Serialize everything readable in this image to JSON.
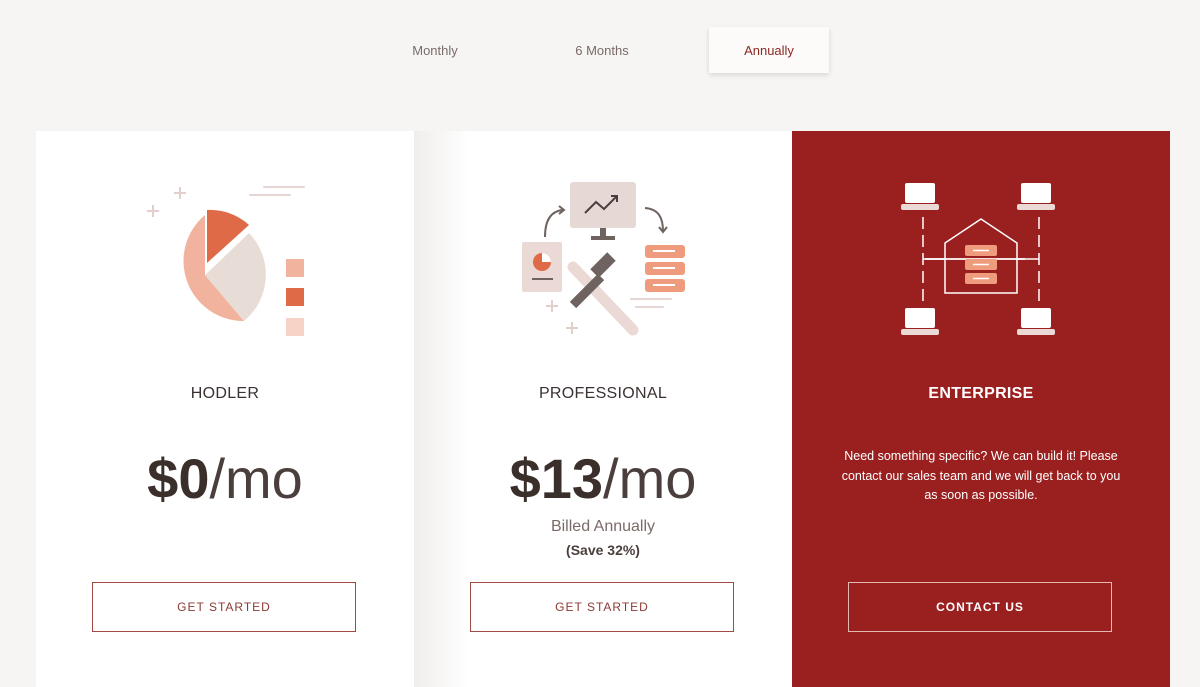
{
  "billing_tabs": [
    {
      "label": "Monthly"
    },
    {
      "label": "6 Months"
    },
    {
      "label": "Annually",
      "selected": true
    }
  ],
  "plans": [
    {
      "name": "HODLER",
      "price_amount": "$0",
      "price_period": "/mo",
      "button_label": "GET STARTED",
      "icon": "pie-chart-illustration"
    },
    {
      "name": "PROFESSIONAL",
      "price_amount": "$13",
      "price_period": "/mo",
      "billed_note": "Billed Annually",
      "savings_note": "(Save 32%)",
      "button_label": "GET STARTED",
      "icon": "tools-illustration"
    },
    {
      "name": "ENTERPRISE",
      "description": "Need something specific? We can build it! Please contact our sales team and we will get back to you as soon as possible.",
      "button_label": "CONTACT US",
      "icon": "network-house-illustration"
    }
  ],
  "colors": {
    "accent": "#9a1f1f",
    "accent_orange": "#de6a47",
    "peach": "#f0b39c",
    "page_bg": "#f6f5f4"
  }
}
